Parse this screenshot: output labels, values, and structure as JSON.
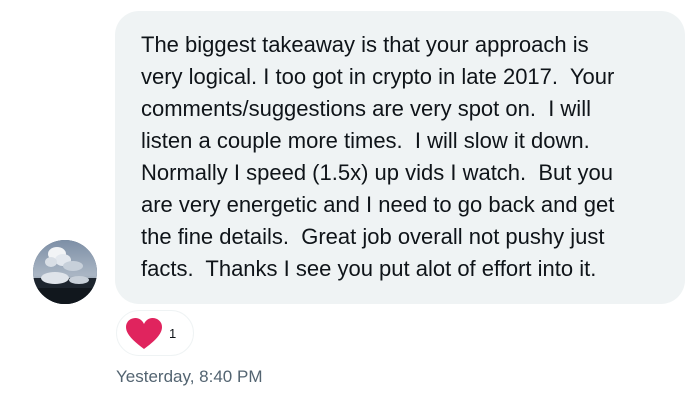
{
  "message": {
    "text": "The biggest takeaway is that your approach is\nvery logical. I too got in crypto in late 2017.  Your\ncomments/suggestions are very spot on.  I will\nlisten a couple more times.  I will slow it down.\nNormally I speed (1.5x) up vids I watch.  But you\nare very energetic and I need to go back and get\nthe fine details.  Great job overall not pushy just\nfacts.  Thanks I see you put alot of effort into it.",
    "timestamp": "Yesterday, 8:40 PM"
  },
  "reaction": {
    "icon": "heart-icon",
    "count": "1",
    "color": "#e0245e"
  },
  "colors": {
    "bubble_bg": "#eff3f4",
    "text": "#0f1419",
    "muted": "#536471"
  }
}
